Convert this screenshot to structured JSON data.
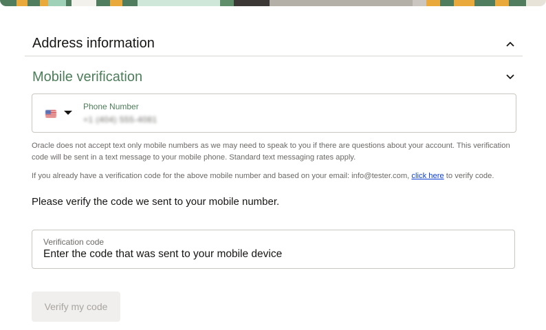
{
  "address_section": {
    "title": "Address information",
    "expanded": true,
    "icon": "chevron-up-icon"
  },
  "mobile_section": {
    "title": "Mobile verification",
    "expanded": false,
    "icon": "chevron-down-icon",
    "accent_color": "#4d7d59"
  },
  "phone": {
    "country_icon": "us-flag-icon",
    "label": "Phone Number",
    "value": "+1 (404) 555-4081"
  },
  "help": {
    "text1": "Oracle does not accept text only mobile numbers as we may need to speak to you if there are questions about your account. This verification code will be sent in a text message to your mobile phone. Standard text messaging rates apply.",
    "text2_before": "If you already have a verification code for the above mobile number and based on your email: info@tester.com,",
    "link_label": "click here",
    "text2_after": "to verify code."
  },
  "verify_message": "Please verify the code we sent to your mobile number.",
  "code": {
    "label": "Verification code",
    "placeholder": "Enter the code that was sent to your mobile device",
    "value": ""
  },
  "verify_button": {
    "label": "Verify my code",
    "disabled": true
  }
}
